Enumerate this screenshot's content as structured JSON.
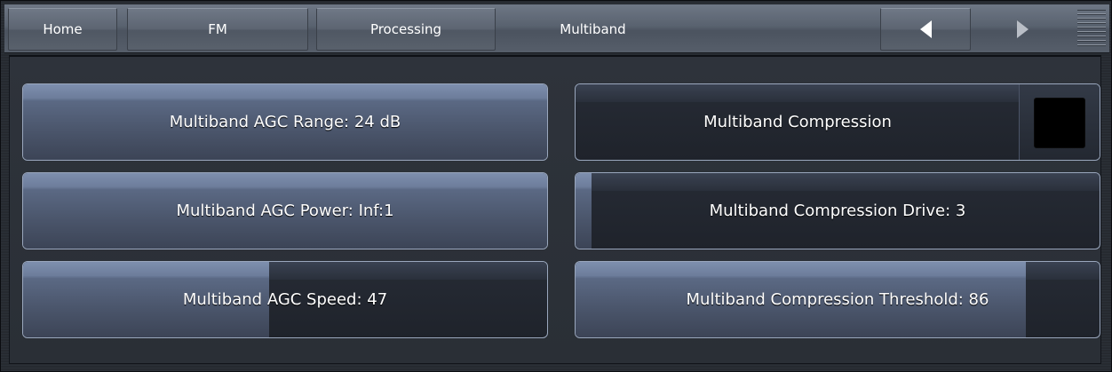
{
  "nav": {
    "home": "Home",
    "fm": "FM",
    "processing": "Processing",
    "current": "Multiband",
    "back_icon": "triangle-left-icon",
    "forward_icon": "triangle-right-icon",
    "menu_icon": "menu-lines-icon"
  },
  "controls": {
    "agc_range": {
      "label": "Multiband AGC Range: 24 dB",
      "level": 1.0
    },
    "agc_power": {
      "label": "Multiband AGC Power: Inf:1",
      "level": 1.0
    },
    "agc_speed": {
      "label": "Multiband AGC Speed: 47",
      "level": 0.47
    },
    "compression": {
      "label": "Multiband Compression",
      "enabled": false
    },
    "compression_drive": {
      "label": "Multiband Compression Drive: 3",
      "level": 0.03
    },
    "compression_threshold": {
      "label": "Multiband Compression Threshold: 86",
      "level": 0.86
    }
  },
  "colors": {
    "accent_fill": "#6d7d9b",
    "border": "#9aa7bd",
    "background": "#2a2f36"
  }
}
